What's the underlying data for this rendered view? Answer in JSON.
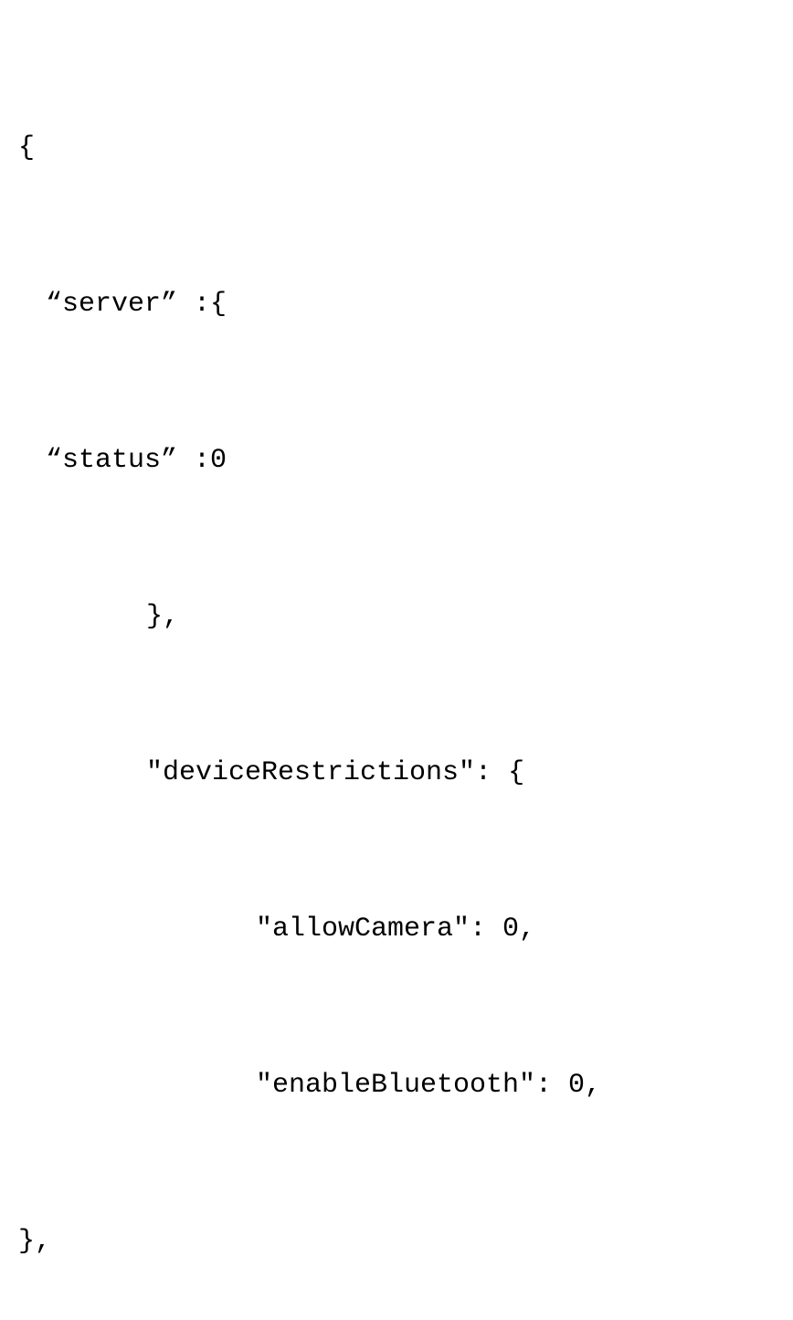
{
  "code": {
    "line1": "{",
    "line2": "“server” :{",
    "line3": "“status” :0",
    "line4": "},",
    "line5": "″deviceRestrictions″: {",
    "line6": "″allowCamera″: 0,",
    "line7": "″enableBluetooth″: 0,",
    "line8": "},"
  }
}
